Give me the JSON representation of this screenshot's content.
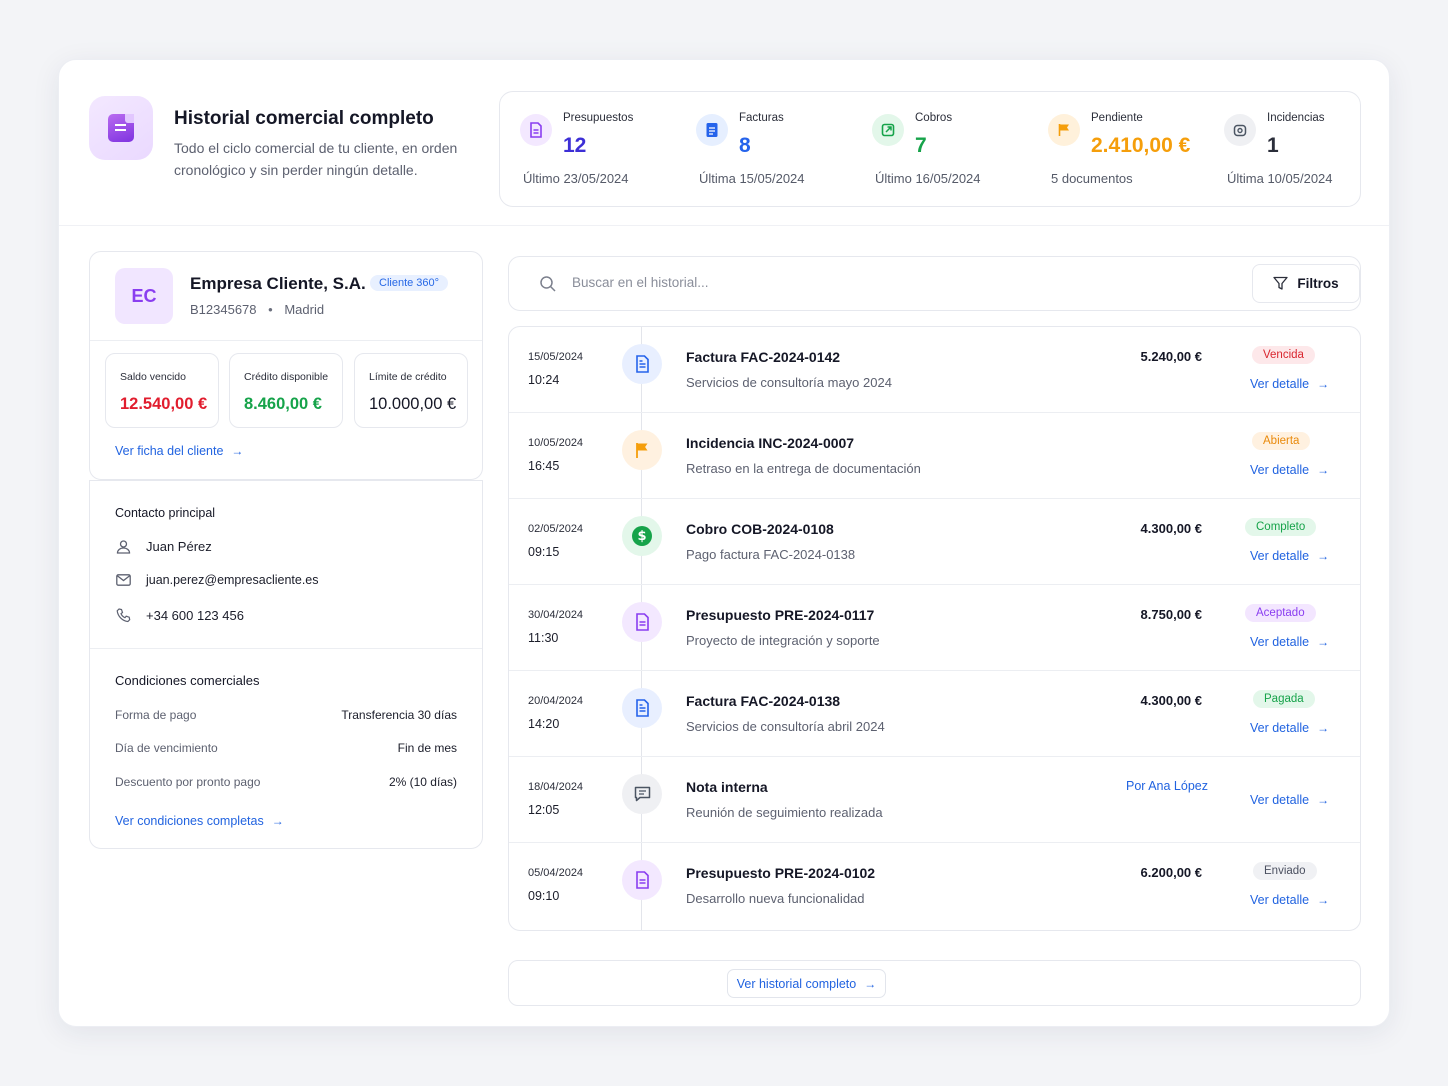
{
  "header": {
    "title": "Historial comercial completo",
    "subtitle": "Todo el ciclo comercial de tu cliente, en orden cronológico y sin perder ningún detalle.",
    "icon": "document-icon"
  },
  "stats": [
    {
      "label": "Presupuestos",
      "value": "12",
      "foot": "Último 23/05/2024",
      "icon": "quote-icon",
      "color": "#7b3fe4"
    },
    {
      "label": "Facturas",
      "value": "8",
      "foot": "Última 15/05/2024",
      "icon": "invoice-icon",
      "color": "#2563eb"
    },
    {
      "label": "Cobros",
      "value": "7",
      "foot": "Último 16/05/2024",
      "icon": "payment-icon",
      "color": "#16a34a"
    },
    {
      "label": "Pendiente",
      "value": "2.410,00 €",
      "foot": "5 documentos",
      "icon": "flag-icon",
      "color": "#f59e0b"
    },
    {
      "label": "Incidencias",
      "value": "1",
      "foot": "Última 10/05/2024",
      "icon": "alert-icon",
      "color": "#4b5563"
    }
  ],
  "client": {
    "initials": "EC",
    "name": "Empresa Cliente, S.A.",
    "badge": "Cliente 360°",
    "tax_id": "B12345678",
    "city": "Madrid",
    "metrics": [
      {
        "label": "Saldo vencido",
        "value": "12.540,00 €",
        "color": "#e11d2e"
      },
      {
        "label": "Crédito disponible",
        "value": "8.460,00 €",
        "color": "#16a34a"
      },
      {
        "label": "Límite de crédito",
        "value": "10.000,00 €",
        "color": "#151726"
      }
    ],
    "link": "Ver ficha del cliente"
  },
  "contact": {
    "title": "Contacto principal",
    "name": "Juan Pérez",
    "email": "juan.perez@empresacliente.es",
    "phone": "+34 600 123 456"
  },
  "conditions": {
    "title": "Condiciones comerciales",
    "rows": [
      {
        "key": "Forma de pago",
        "value": "Transferencia 30 días"
      },
      {
        "key": "Día de vencimiento",
        "value": "Fin de mes"
      },
      {
        "key": "Descuento por pronto pago",
        "value": "2% (10 días)"
      }
    ],
    "link": "Ver condiciones completas"
  },
  "search": {
    "placeholder": "Buscar en el historial...",
    "filters_label": "Filtros"
  },
  "timeline": {
    "link_label": "Ver detalle",
    "items": [
      {
        "date": "15/05/2024",
        "time": "10:24",
        "title": "Factura FAC-2024-0142",
        "desc": "Servicios de consultoría mayo 2024",
        "amount": "5.240,00 €",
        "status": "Vencida",
        "icon": "invoice-icon"
      },
      {
        "date": "10/05/2024",
        "time": "16:45",
        "title": "Incidencia INC-2024-0007",
        "desc": "Retraso en la entrega de documentación",
        "amount": "",
        "status": "Abierta",
        "icon": "flag-icon"
      },
      {
        "date": "02/05/2024",
        "time": "09:15",
        "title": "Cobro COB-2024-0108",
        "desc": "Pago factura FAC-2024-0138",
        "amount": "4.300,00 €",
        "status": "Completo",
        "icon": "dollar-icon"
      },
      {
        "date": "30/04/2024",
        "time": "11:30",
        "title": "Presupuesto PRE-2024-0117",
        "desc": "Proyecto de integración y soporte",
        "amount": "8.750,00 €",
        "status": "Aceptado",
        "icon": "quote-icon"
      },
      {
        "date": "20/04/2024",
        "time": "14:20",
        "title": "Factura FAC-2024-0138",
        "desc": "Servicios de consultoría abril 2024",
        "amount": "4.300,00 €",
        "status": "Pagada",
        "icon": "invoice-icon"
      },
      {
        "date": "18/04/2024",
        "time": "12:05",
        "title": "Nota interna",
        "desc": "Reunión de seguimiento realizada",
        "author": "Por Ana López",
        "status": "",
        "icon": "chat-icon"
      },
      {
        "date": "05/04/2024",
        "time": "09:10",
        "title": "Presupuesto PRE-2024-0102",
        "desc": "Desarrollo nueva funcionalidad",
        "amount": "6.200,00 €",
        "status": "Enviado",
        "icon": "quote-icon"
      }
    ]
  },
  "footer": {
    "button": "Ver historial completo"
  }
}
